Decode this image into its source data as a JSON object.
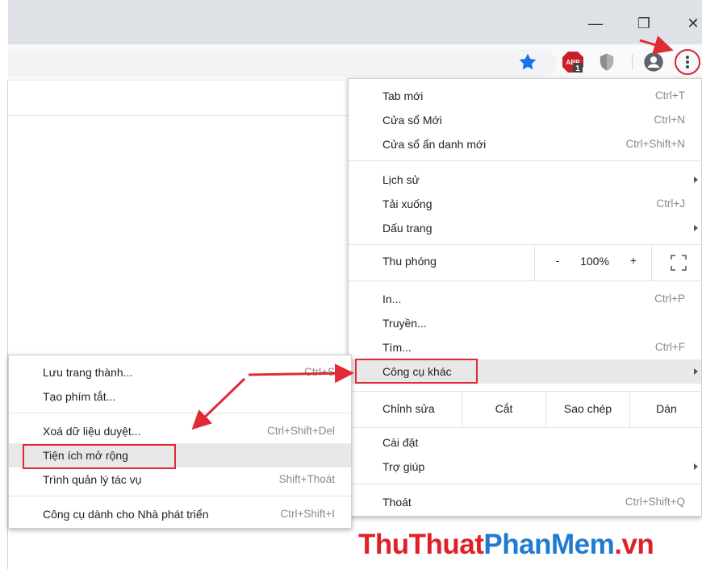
{
  "window": {
    "minimize": "—",
    "restore": "❐",
    "close": "✕"
  },
  "toolbar": {
    "abp_badge": "1",
    "abp_text": "ABP"
  },
  "main_menu": {
    "items": [
      {
        "label": "Tab mới",
        "shortcut": "Ctrl+T"
      },
      {
        "label": "Cửa sổ Mới",
        "shortcut": "Ctrl+N"
      },
      {
        "label": "Cửa sổ ẩn danh mới",
        "shortcut": "Ctrl+Shift+N"
      },
      {
        "label": "Lịch sử",
        "shortcut": ""
      },
      {
        "label": "Tải xuống",
        "shortcut": "Ctrl+J"
      },
      {
        "label": "Dấu trang",
        "shortcut": ""
      },
      {
        "label": "In...",
        "shortcut": "Ctrl+P"
      },
      {
        "label": "Truyền...",
        "shortcut": ""
      },
      {
        "label": "Tìm...",
        "shortcut": "Ctrl+F"
      },
      {
        "label": "Công cụ khác",
        "shortcut": ""
      },
      {
        "label": "Cài đặt",
        "shortcut": ""
      },
      {
        "label": "Trợ giúp",
        "shortcut": ""
      },
      {
        "label": "Thoát",
        "shortcut": "Ctrl+Shift+Q"
      }
    ],
    "zoom": {
      "label": "Thu phóng",
      "minus": "-",
      "value": "100%",
      "plus": "+"
    },
    "edit": {
      "label": "Chỉnh sửa",
      "cut": "Cắt",
      "copy": "Sao chép",
      "paste": "Dán"
    }
  },
  "sub_menu": {
    "items": [
      {
        "label": "Lưu trang thành...",
        "shortcut": "Ctrl+S"
      },
      {
        "label": "Tạo phím tắt...",
        "shortcut": ""
      },
      {
        "label": "Xoá dữ liệu duyệt...",
        "shortcut": "Ctrl+Shift+Del"
      },
      {
        "label": "Tiện ích mở rộng",
        "shortcut": ""
      },
      {
        "label": "Trình quản lý tác vụ",
        "shortcut": "Shift+Thoát"
      },
      {
        "label": "Công cụ dành cho Nhà phát triển",
        "shortcut": "Ctrl+Shift+I"
      }
    ]
  },
  "watermark": {
    "part1": "ThuThuat",
    "part2": "PhanMem",
    "part3": ".vn"
  },
  "colors": {
    "accent_red": "#e02b35",
    "star_blue": "#1a73e8",
    "watermark_blue": "#1f7bd1"
  }
}
